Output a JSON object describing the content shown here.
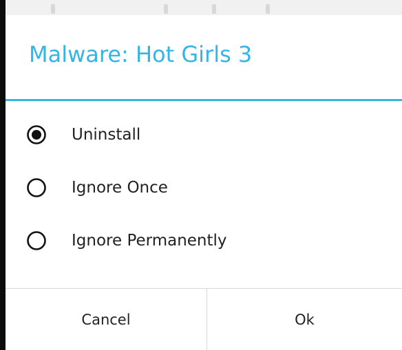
{
  "dialog": {
    "title": "Malware: Hot Girls 3",
    "options": [
      {
        "label": "Uninstall",
        "selected": true
      },
      {
        "label": "Ignore Once",
        "selected": false
      },
      {
        "label": "Ignore Permanently",
        "selected": false
      }
    ],
    "buttons": {
      "cancel": "Cancel",
      "ok": "Ok"
    }
  },
  "colors": {
    "accent": "#33b5e5",
    "text": "#222222",
    "divider": "#d7d7d7"
  }
}
